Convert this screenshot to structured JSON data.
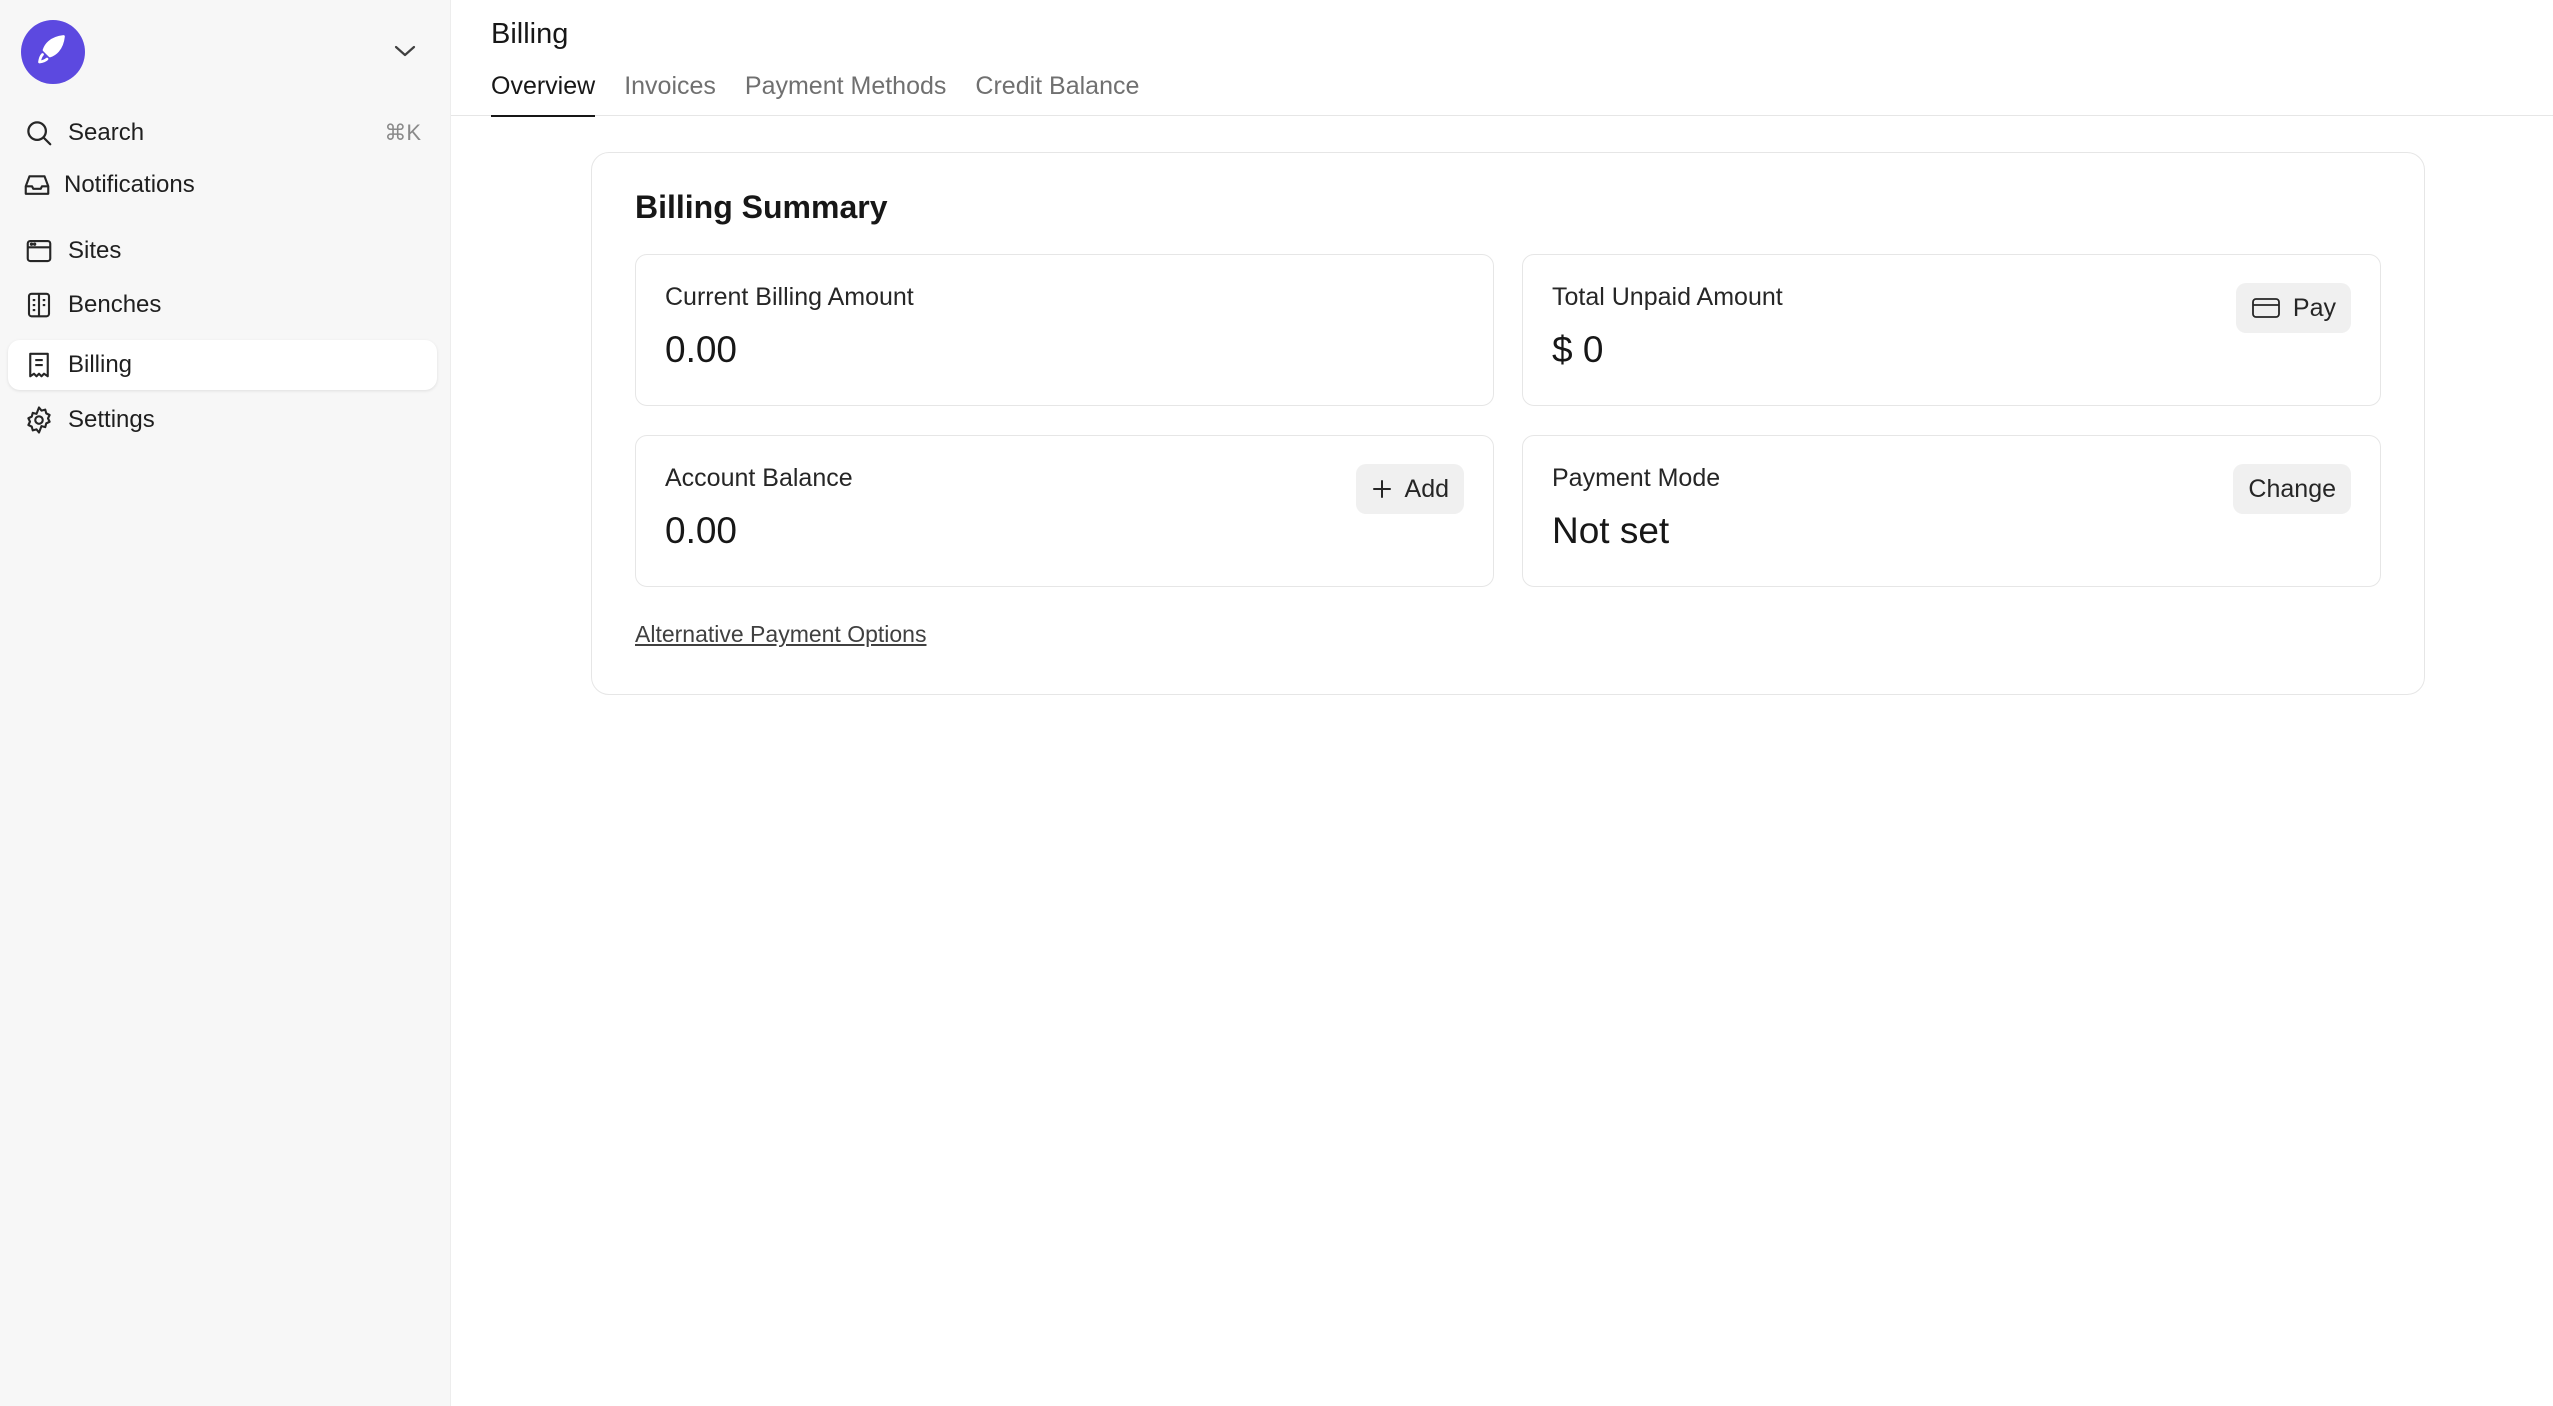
{
  "sidebar": {
    "items": [
      {
        "label": "Search",
        "shortcut": "⌘K",
        "icon": "search-icon"
      },
      {
        "label": "Notifications",
        "icon": "inbox-icon"
      },
      {
        "label": "Sites",
        "icon": "browser-window-icon"
      },
      {
        "label": "Benches",
        "icon": "bench-icon"
      },
      {
        "label": "Billing",
        "icon": "receipt-icon"
      },
      {
        "label": "Settings",
        "icon": "gear-icon"
      }
    ],
    "active_item": "Billing"
  },
  "header": {
    "title": "Billing",
    "tabs": [
      {
        "label": "Overview"
      },
      {
        "label": "Invoices"
      },
      {
        "label": "Payment Methods"
      },
      {
        "label": "Credit Balance"
      }
    ],
    "active_tab": "Overview"
  },
  "summary": {
    "title": "Billing Summary",
    "current_billing": {
      "label": "Current Billing Amount",
      "value": "0.00"
    },
    "unpaid": {
      "label": "Total Unpaid Amount",
      "value": "$ 0",
      "action": "Pay"
    },
    "account_balance": {
      "label": "Account Balance",
      "value": "0.00",
      "action": "Add"
    },
    "payment_mode": {
      "label": "Payment Mode",
      "value": "Not set",
      "action": "Change"
    },
    "alt_link": "Alternative Payment Options"
  },
  "colors": {
    "brand": "#5c49e0"
  }
}
